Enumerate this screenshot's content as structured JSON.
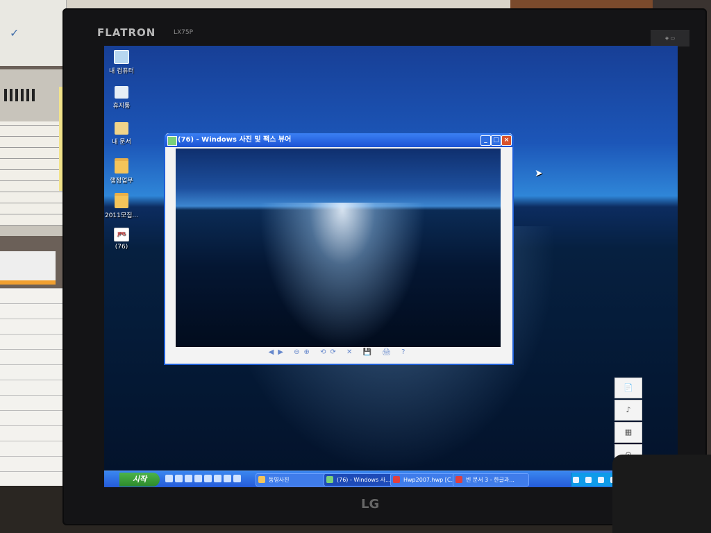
{
  "monitor": {
    "brand": "FLATRON",
    "model": "LX75P",
    "maker_logo": "LG"
  },
  "desktop": {
    "icons": [
      {
        "label": "내 컴퓨터",
        "icon": "computer-icon"
      },
      {
        "label": "휴지통",
        "icon": "recycle-bin-icon"
      },
      {
        "label": "내 문서",
        "icon": "documents-folder-icon"
      },
      {
        "label": "행정업무",
        "icon": "folder-icon"
      },
      {
        "label": "2011모집...",
        "icon": "folder-icon"
      },
      {
        "label": "(76)",
        "icon": "jpg-file-icon"
      }
    ]
  },
  "viewer": {
    "title": "(76) - Windows 사진 및 팩스 뷰어",
    "minimize": "_",
    "maximize": "□",
    "close": "×",
    "toolbar_glyphs": "◀▶ ⊖⊕ ⟲⟳ ✕ 💾 🖨 ?"
  },
  "taskbar": {
    "start_label": "시작",
    "tasks": [
      {
        "label": "동영사진",
        "icon_color": "#f4c45a"
      },
      {
        "label": "(76) - Windows 사...",
        "icon_color": "#7ad07a"
      },
      {
        "label": "Hwp2007.hwp [C...",
        "icon_color": "#e04040"
      },
      {
        "label": "빈 문서 3 - 한글과...",
        "icon_color": "#e04040"
      }
    ]
  },
  "stickers": [
    "📄",
    "♪",
    "▦",
    "⊙"
  ]
}
